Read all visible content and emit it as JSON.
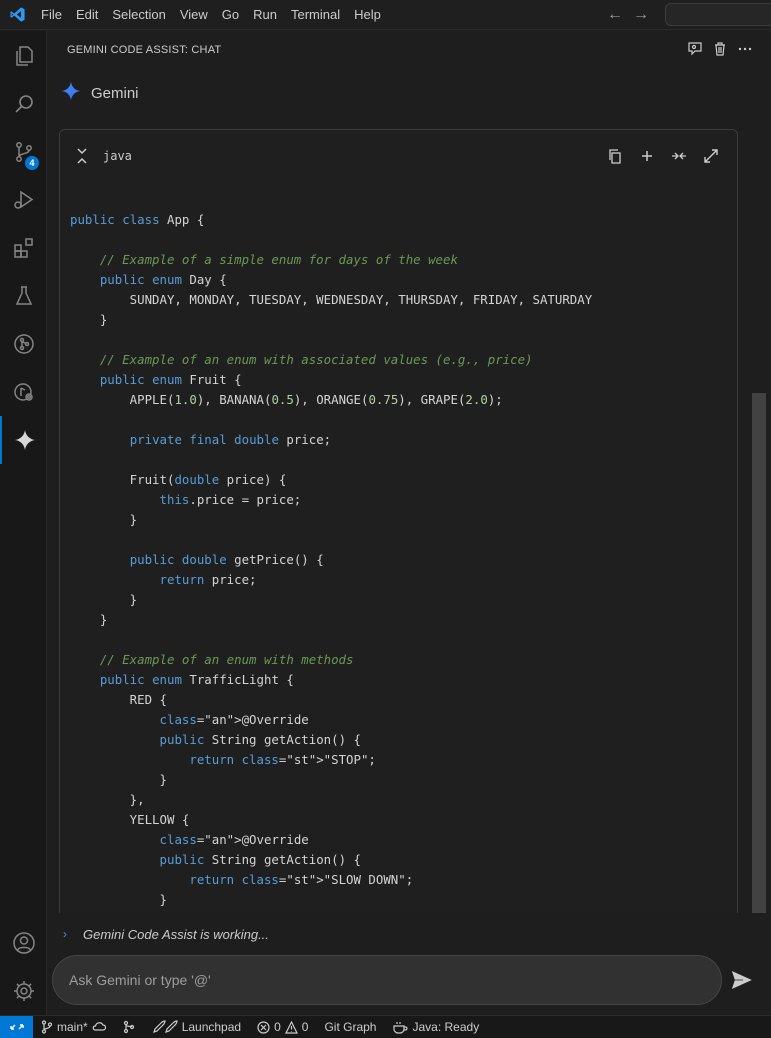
{
  "menu": [
    "File",
    "Edit",
    "Selection",
    "View",
    "Go",
    "Run",
    "Terminal",
    "Help"
  ],
  "nav": {
    "back": "←",
    "forward": "→"
  },
  "activity": {
    "source_control_badge": "4"
  },
  "panel": {
    "title": "GEMINI CODE ASSIST: CHAT"
  },
  "chat": {
    "author": "Gemini"
  },
  "codeblock": {
    "language": "java"
  },
  "code_lines": [
    "public class App {",
    "",
    "    // Example of a simple enum for days of the week",
    "    public enum Day {",
    "        SUNDAY, MONDAY, TUESDAY, WEDNESDAY, THURSDAY, FRIDAY, SATURDAY",
    "    }",
    "",
    "    // Example of an enum with associated values (e.g., price)",
    "    public enum Fruit {",
    "        APPLE(1.0), BANANA(0.5), ORANGE(0.75), GRAPE(2.0);",
    "",
    "        private final double price;",
    "",
    "        Fruit(double price) {",
    "            this.price = price;",
    "        }",
    "",
    "        public double getPrice() {",
    "            return price;",
    "        }",
    "    }",
    "",
    "    // Example of an enum with methods",
    "    public enum TrafficLight {",
    "        RED {",
    "            @Override",
    "            public String getAction() {",
    "                return \"STOP\";",
    "            }",
    "        },",
    "        YELLOW {",
    "            @Override",
    "            public String getAction() {",
    "                return \"SLOW DOWN\";",
    "            }",
    "        },"
  ],
  "status": {
    "working": "Gemini Code Assist is working..."
  },
  "input": {
    "placeholder": "Ask Gemini or type '@'"
  },
  "statusbar": {
    "branch": "main*",
    "launchpad": "Launchpad",
    "errors": "0",
    "warnings": "0",
    "git_graph": "Git Graph",
    "java": "Java: Ready"
  },
  "colors": {
    "accent": "#0078d4",
    "keyword": "#569cd6",
    "comment": "#6a9955",
    "number": "#b5cea8",
    "string": "#ce9178"
  }
}
